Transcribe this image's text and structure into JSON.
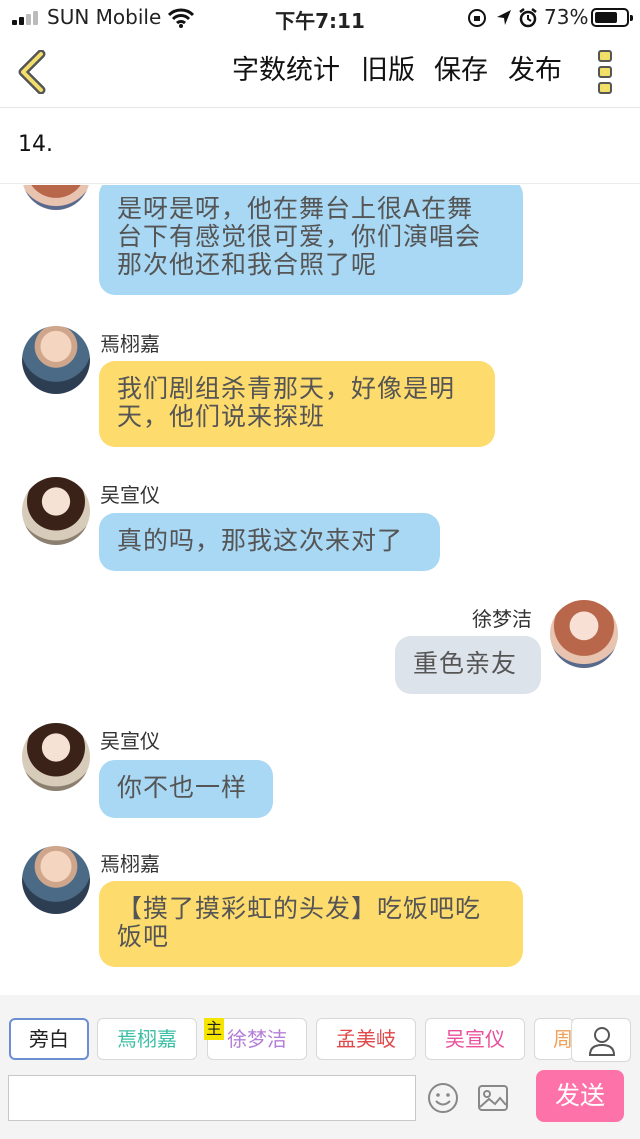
{
  "status_bar": {
    "carrier": "SUN Mobile",
    "time": "下午7:11",
    "battery_percent": "73%",
    "battery_level": 0.73
  },
  "toolbar": {
    "word_count_label": "字数统计",
    "old_version_label": "旧版",
    "save_label": "保存",
    "publish_label": "发布"
  },
  "chapter": {
    "title": "14."
  },
  "messages": [
    {
      "speaker": "",
      "side": "left",
      "color": "blue",
      "text_lines": [
        "是呀是呀，他在舞台上很A在舞",
        "台下有感觉很可爱，你们演唱会",
        "那次他还和我合照了呢"
      ]
    },
    {
      "speaker": "焉栩嘉",
      "side": "left",
      "color": "yellow",
      "text_lines": [
        "我们剧组杀青那天，好像是明",
        "天，他们说来探班"
      ]
    },
    {
      "speaker": "吴宣仪",
      "side": "left",
      "color": "blue",
      "text_lines": [
        "真的吗，那我这次来对了"
      ]
    },
    {
      "speaker": "徐梦洁",
      "side": "right",
      "color": "grey",
      "text_lines": [
        "重色亲友"
      ]
    },
    {
      "speaker": "吴宣仪",
      "side": "left",
      "color": "blue",
      "text_lines": [
        "你不也一样"
      ]
    },
    {
      "speaker": "焉栩嘉",
      "side": "left",
      "color": "yellow",
      "text_lines": [
        "【摸了摸彩虹的头发】吃饭吧吃",
        "饭吧"
      ]
    }
  ],
  "role_bar": {
    "roles": [
      {
        "label": "旁白",
        "color": "#222222"
      },
      {
        "label": "焉栩嘉",
        "color": "#3cbfa5"
      },
      {
        "label": "徐梦洁",
        "color": "#b47fd8"
      },
      {
        "label": "孟美岐",
        "color": "#e0484a"
      },
      {
        "label": "吴宣仪",
        "color": "#e94f9a"
      },
      {
        "label": "周",
        "color": "#f0a058"
      }
    ],
    "host_tag": "主",
    "input_value": "",
    "input_placeholder": "",
    "send_label": "发送"
  }
}
